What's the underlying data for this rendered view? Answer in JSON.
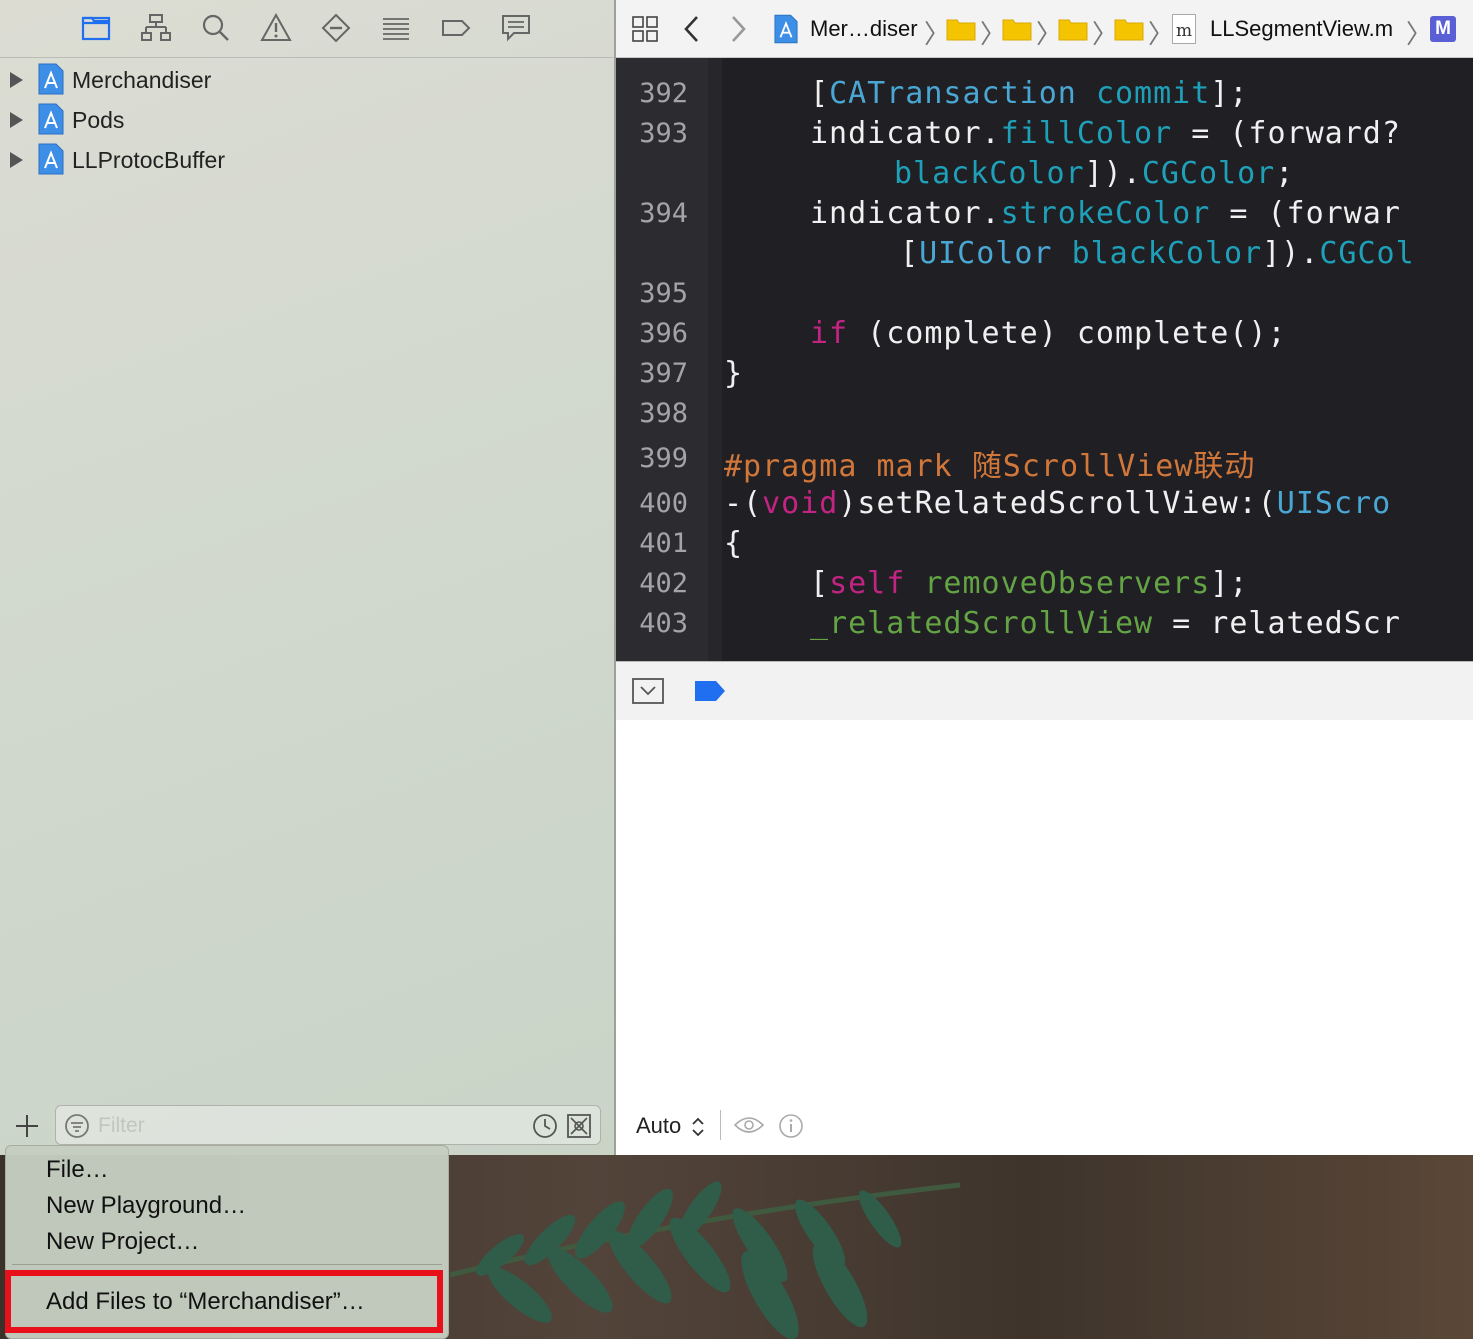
{
  "navigator": {
    "toolbar_icons": [
      "folder-icon",
      "hierarchy-icon",
      "search-icon",
      "warning-icon",
      "diamond-icon",
      "list-icon",
      "tag-icon",
      "comment-icon"
    ],
    "items": [
      {
        "label": "Merchandiser",
        "icon": "xcode-project-icon"
      },
      {
        "label": "Pods",
        "icon": "xcode-project-icon"
      },
      {
        "label": "LLProtocBuffer",
        "icon": "xcode-project-icon"
      }
    ],
    "filter": {
      "placeholder": "Filter",
      "value": ""
    }
  },
  "jumpbar": {
    "project": "Mer…diser",
    "file": "LLSegmentView.m",
    "file_icon_letter": "m",
    "method_icon_letter": "M"
  },
  "editor": {
    "line_numbers": [
      "392",
      "393",
      "",
      "394",
      "",
      "395",
      "396",
      "397",
      "398",
      "399",
      "400",
      "401",
      "402",
      "403"
    ],
    "lines": [
      "[CATransaction commit];",
      "indicator.fillColor = (forward?",
      "blackColor]).CGColor;",
      "indicator.strokeColor = (forwar",
      "[UIColor blackColor]).CGCol",
      "",
      "if (complete) complete();",
      "}",
      "",
      "#pragma mark 随ScrollView联动",
      "-(void)setRelatedScrollView:(UIScro",
      "{",
      "[self removeObservers];",
      "_relatedScrollView = relatedScr"
    ]
  },
  "console": {
    "mode": "Auto"
  },
  "menu": {
    "items": [
      "File…",
      "New Playground…",
      "New Project…",
      "Add Files to “Merchandiser”…"
    ]
  },
  "colors": {
    "editor_bg": "#1f1f24",
    "class": "#4aa7d4",
    "keyword": "#c32483",
    "pragma": "#d2773a",
    "highlight": "#e8101a",
    "accent": "#1f6ff0"
  }
}
